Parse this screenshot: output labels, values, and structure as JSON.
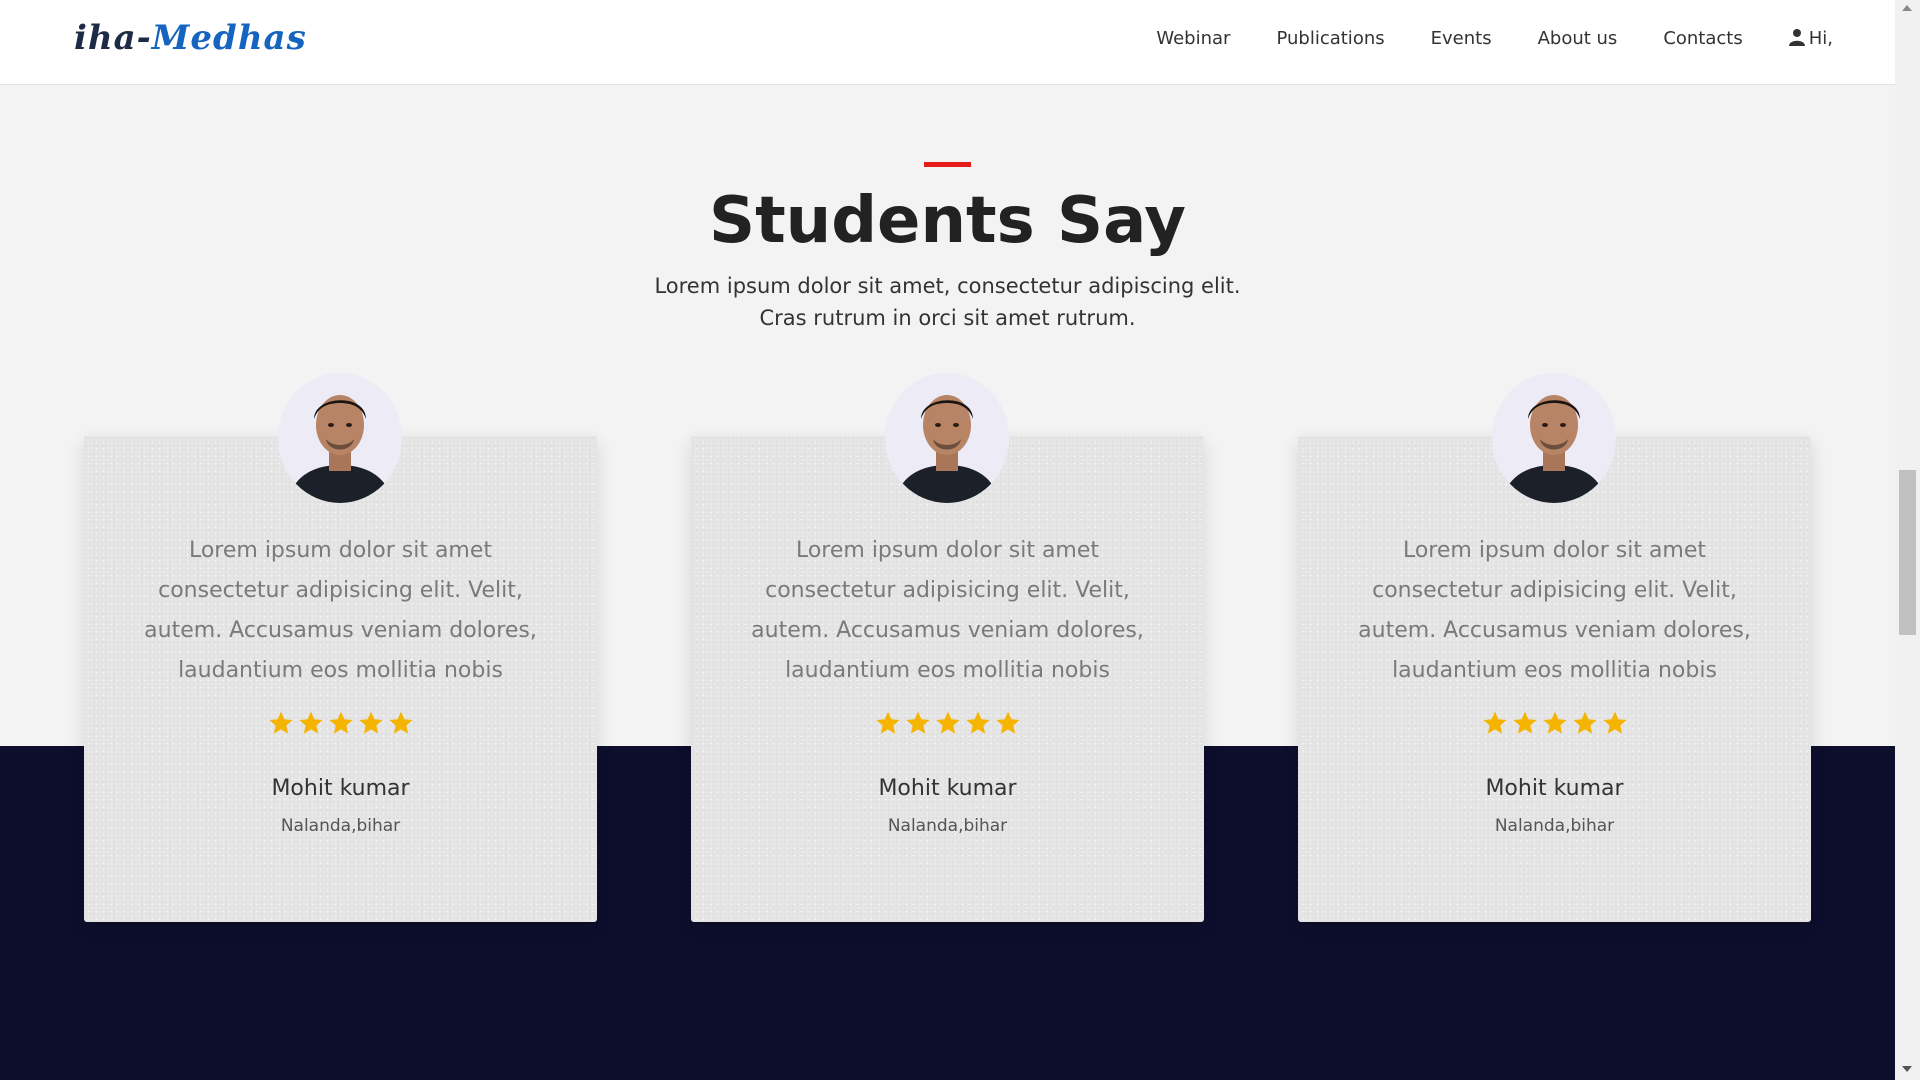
{
  "brand": {
    "logo_part1": "iha-",
    "logo_part2": "Medhas"
  },
  "nav": {
    "items": [
      "Webinar",
      "Publications",
      "Events",
      "About us",
      "Contacts"
    ],
    "user_label": "Hi,"
  },
  "section": {
    "title": "Students Say",
    "subtitle_line1": "Lorem ipsum dolor sit amet, consectetur adipiscing elit.",
    "subtitle_line2": "Cras rutrum in orci sit amet rutrum."
  },
  "testimonials": [
    {
      "quote": "Lorem ipsum dolor sit amet consectetur adipisicing elit. Velit, autem. Accusamus veniam dolores, laudantium eos mollitia nobis",
      "rating": 5,
      "name": "Mohit kumar",
      "location": "Nalanda,bihar"
    },
    {
      "quote": "Lorem ipsum dolor sit amet consectetur adipisicing elit. Velit, autem. Accusamus veniam dolores, laudantium eos mollitia nobis",
      "rating": 5,
      "name": "Mohit kumar",
      "location": "Nalanda,bihar"
    },
    {
      "quote": "Lorem ipsum dolor sit amet consectetur adipisicing elit. Velit, autem. Accusamus veniam dolores, laudantium eos mollitia nobis",
      "rating": 5,
      "name": "Mohit kumar",
      "location": "Nalanda,bihar"
    }
  ],
  "colors": {
    "accent": "#e41b17",
    "star": "#f4b400",
    "dark_band": "#0c0e2c",
    "logo_blue": "#1565c0"
  },
  "icons": {
    "user": "user-icon",
    "star": "star-icon",
    "avatar": "student-avatar"
  }
}
